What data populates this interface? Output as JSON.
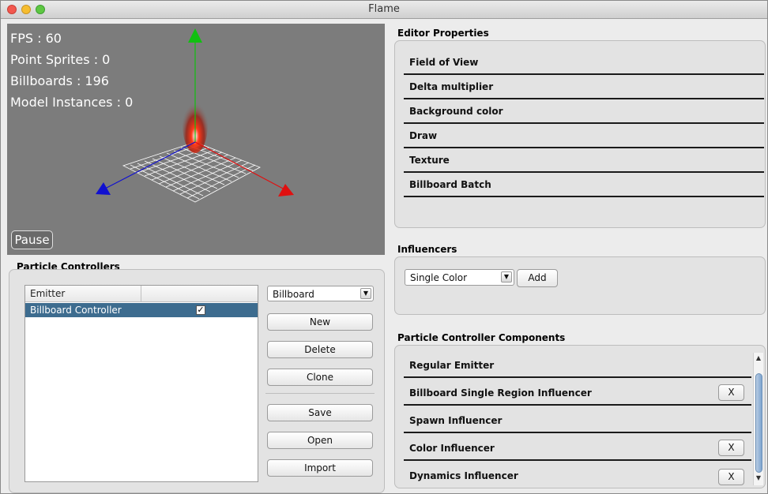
{
  "window": {
    "title": "Flame"
  },
  "viewport": {
    "stats": [
      "FPS : 60",
      "Point Sprites : 0",
      "Billboards : 196",
      "Model Instances : 0"
    ],
    "pause_label": "Pause"
  },
  "particle_controllers": {
    "title": "Particle Controllers",
    "columns": [
      "Emitter",
      ""
    ],
    "rows": [
      {
        "name": "Billboard Controller",
        "enabled": "✓"
      }
    ],
    "type_select": "Billboard",
    "buttons": {
      "new": "New",
      "delete": "Delete",
      "clone": "Clone",
      "save": "Save",
      "open": "Open",
      "import": "Import"
    }
  },
  "editor_properties": {
    "title": "Editor Properties",
    "items": [
      "Field of View",
      "Delta multiplier",
      "Background color",
      "Draw",
      "Texture",
      "Billboard Batch"
    ]
  },
  "influencers": {
    "title": "Influencers",
    "select": "Single Color",
    "add_label": "Add"
  },
  "components": {
    "title": "Particle Controller Components",
    "items": [
      {
        "label": "Regular Emitter",
        "remove": ""
      },
      {
        "label": "Billboard Single Region Influencer",
        "remove": "X"
      },
      {
        "label": "Spawn Influencer",
        "remove": ""
      },
      {
        "label": "Color Influencer",
        "remove": "X"
      },
      {
        "label": "Dynamics Influencer",
        "remove": "X"
      }
    ]
  },
  "colors": {
    "axis_x": "#e01010",
    "axis_y": "#10c010",
    "axis_z": "#1010d0",
    "selection": "#3d6c8f",
    "viewport_bg": "#7c7c7c"
  }
}
